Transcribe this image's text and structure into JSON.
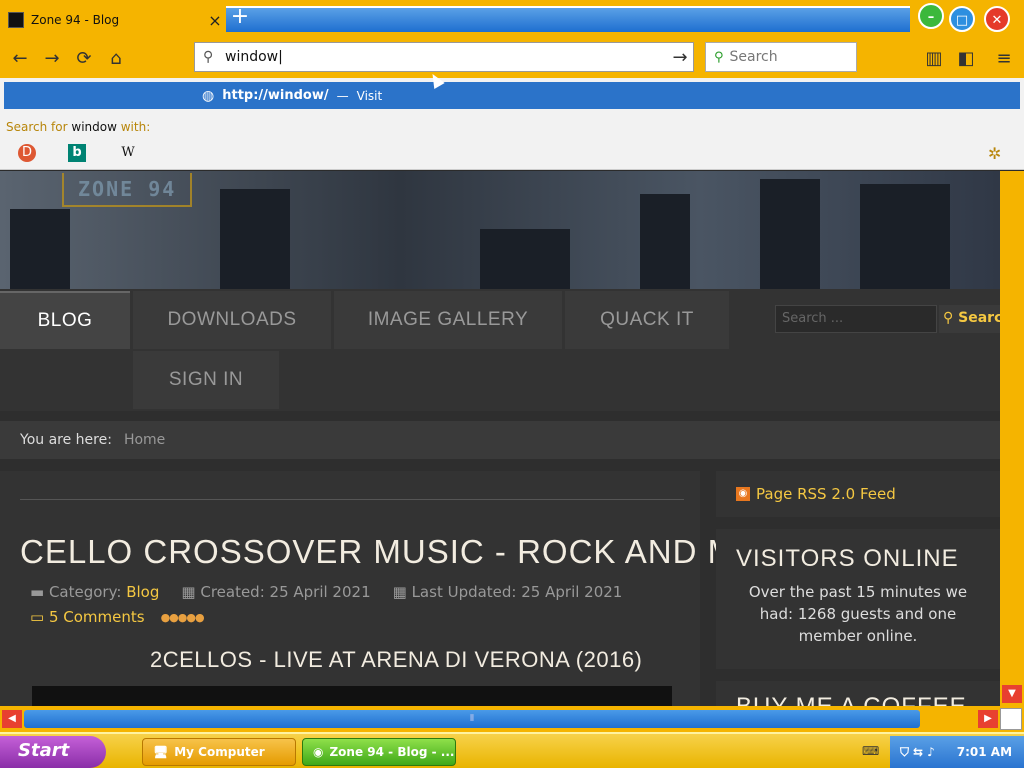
{
  "browser": {
    "tab": {
      "title": "Zone 94 - Blog",
      "close_icon": "×"
    },
    "new_tab_icon": "+",
    "window_buttons": {
      "minimize": "–",
      "maximize": "□",
      "close": "✕"
    },
    "nav": {
      "back_icon": "←",
      "forward_icon": "→",
      "reload_icon": "⟳",
      "home_icon": "⌂"
    },
    "url_bar": {
      "value": "window|",
      "go_icon": "→"
    },
    "search_box": {
      "placeholder": "Search"
    },
    "toolbar_icons": {
      "library": "▥",
      "sidebar": "◧",
      "menu": "≡"
    }
  },
  "url_dropdown": {
    "suggestion": {
      "url": "http://window/",
      "separator": "—",
      "action": "Visit"
    },
    "search_for_prefix": "Search for",
    "search_for_term": "window",
    "search_for_suffix": "with:",
    "engines": {
      "ddg": "D",
      "bing": "b",
      "wiki": "W"
    },
    "settings_icon": "✲"
  },
  "site": {
    "logo_text": "ZONE 94",
    "menu": [
      {
        "label": "BLOG"
      },
      {
        "label": "DOWNLOADS"
      },
      {
        "label": "IMAGE GALLERY"
      },
      {
        "label": "QUACK IT"
      },
      {
        "label": "SIGN IN"
      }
    ],
    "search": {
      "placeholder": "Search ...",
      "button": "Search"
    },
    "breadcrumb": {
      "label": "You are here:",
      "home": "Home"
    },
    "article": {
      "title": "CELLO CROSSOVER MUSIC - ROCK AND METAL",
      "category_label": "Category:",
      "category": "Blog",
      "created": "Created: 25 April 2021",
      "updated": "Last Updated: 25 April 2021",
      "comments": "5 Comments",
      "rating": "●●●●●",
      "subtitle": "2CELLOS - LIVE AT ARENA DI VERONA (2016)"
    },
    "sidebar": {
      "rss": "Page RSS 2.0 Feed",
      "visitors_title": "VISITORS ONLINE",
      "visitors_text": "Over the past 15 minutes we had: 1268 guests and one member online.",
      "coffee_title": "BUY ME A COFFEE"
    }
  },
  "scrollbars": {
    "up_arrow": "▲",
    "down_arrow": "▼",
    "left_arrow": "◀",
    "right_arrow": "▶",
    "grip": "⦀"
  },
  "taskbar": {
    "start": "Start",
    "items": [
      {
        "label": "My Computer"
      },
      {
        "label": "Zone 94 - Blog - ..."
      }
    ],
    "clock": "7:01 AM"
  }
}
